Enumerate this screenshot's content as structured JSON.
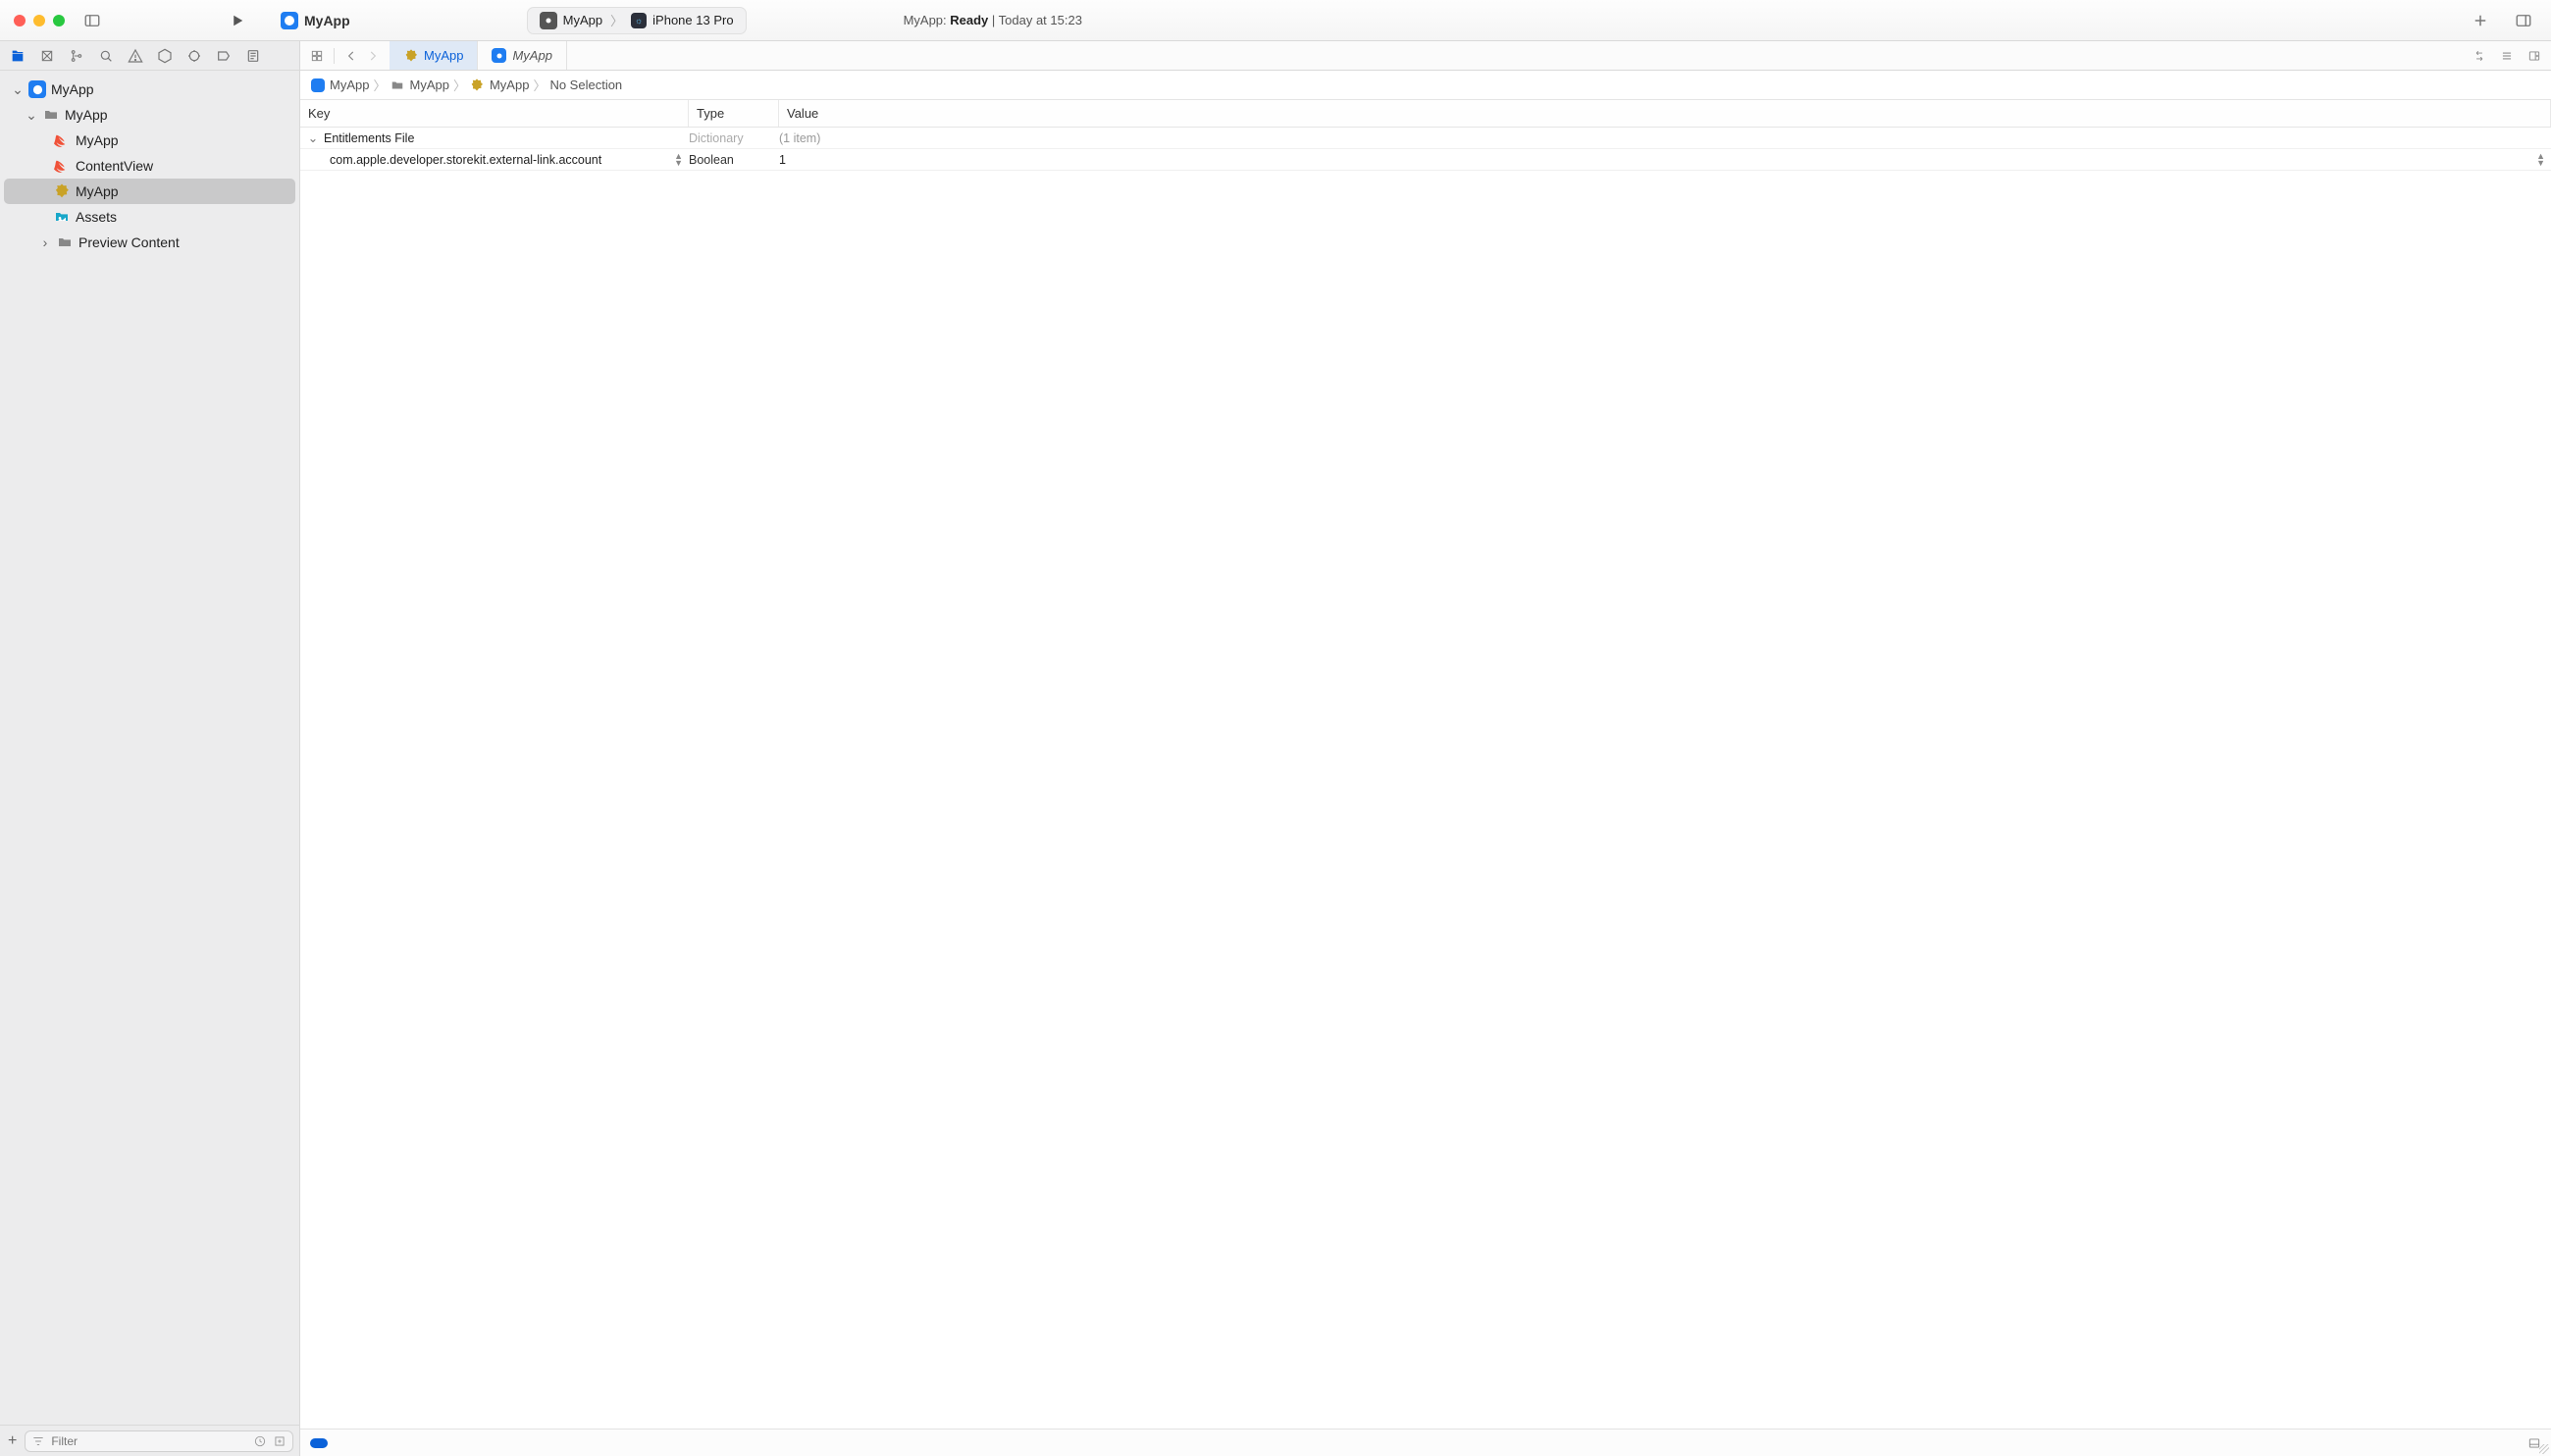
{
  "titlebar": {
    "project_name": "MyApp",
    "scheme": "MyApp",
    "device": "iPhone 13 Pro",
    "status_prefix": "MyApp: ",
    "status_state": "Ready",
    "status_suffix": " | Today at 15:23"
  },
  "navigator": {
    "root": "MyApp",
    "group": "MyApp",
    "items": [
      {
        "label": "MyApp",
        "kind": "swift"
      },
      {
        "label": "ContentView",
        "kind": "swift"
      },
      {
        "label": "MyApp",
        "kind": "entitlements",
        "selected": true
      },
      {
        "label": "Assets",
        "kind": "assets"
      }
    ],
    "preview_group": "Preview Content",
    "filter_placeholder": "Filter"
  },
  "tabs": {
    "active": "MyApp",
    "secondary": "MyApp"
  },
  "jumpbar": {
    "a": "MyApp",
    "b": "MyApp",
    "c": "MyApp",
    "d": "No Selection"
  },
  "plist": {
    "header_key": "Key",
    "header_type": "Type",
    "header_value": "Value",
    "root": {
      "key": "Entitlements File",
      "type": "Dictionary",
      "value": "(1 item)"
    },
    "row1": {
      "key": "com.apple.developer.storekit.external-link.account",
      "type": "Boolean",
      "value": "1"
    }
  }
}
